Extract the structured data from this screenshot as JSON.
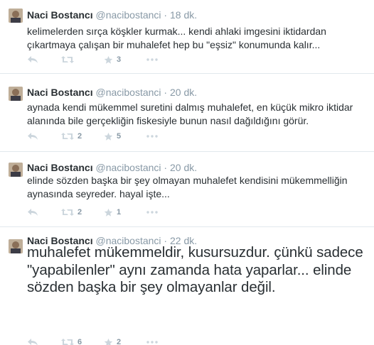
{
  "tweets": [
    {
      "name": "Naci Bostancı",
      "handle": "@nacibostanci",
      "separator": "·",
      "time": "18 dk.",
      "text": "kelimelerden sırça köşkler kurmak... kendi ahlaki imgesini iktidardan çıkartmaya çalışan bir muhalefet hep bu \"eşsiz\" konumunda kalır...",
      "retweets": "",
      "favorites": "3"
    },
    {
      "name": "Naci Bostancı",
      "handle": "@nacibostanci",
      "separator": "·",
      "time": "20 dk.",
      "text": "aynada kendi mükemmel suretini dalmış muhalefet, en küçük mikro iktidar alanında bile gerçekliğin fiskesiyle bunun nasıl dağıldığını görür.",
      "retweets": "2",
      "favorites": "5"
    },
    {
      "name": "Naci Bostancı",
      "handle": "@nacibostanci",
      "separator": "·",
      "time": "20 dk.",
      "text": "elinde sözden başka bir şey olmayan muhalefet kendisini mükemmelliğin aynasında seyreder. hayal işte...",
      "retweets": "2",
      "favorites": "1"
    },
    {
      "name": "Naci Bostancı",
      "handle": "@nacibostanci",
      "separator": "·",
      "time": "22 dk.",
      "text": "muhalefet mükemmeldir, kusursuzdur. çünkü sadece \"yapabilenler\" aynı zamanda hata yaparlar... elinde sözden başka bir şey olmayanlar değil.",
      "retweets": "6",
      "favorites": "2"
    }
  ],
  "icons": {
    "reply": "reply-icon",
    "retweet": "retweet-icon",
    "favorite": "star-icon",
    "more": "more-icon"
  },
  "colors": {
    "name": "#292f33",
    "meta": "#8899a6",
    "icon": "#ccd6dd",
    "divider": "#e1e8ed"
  }
}
